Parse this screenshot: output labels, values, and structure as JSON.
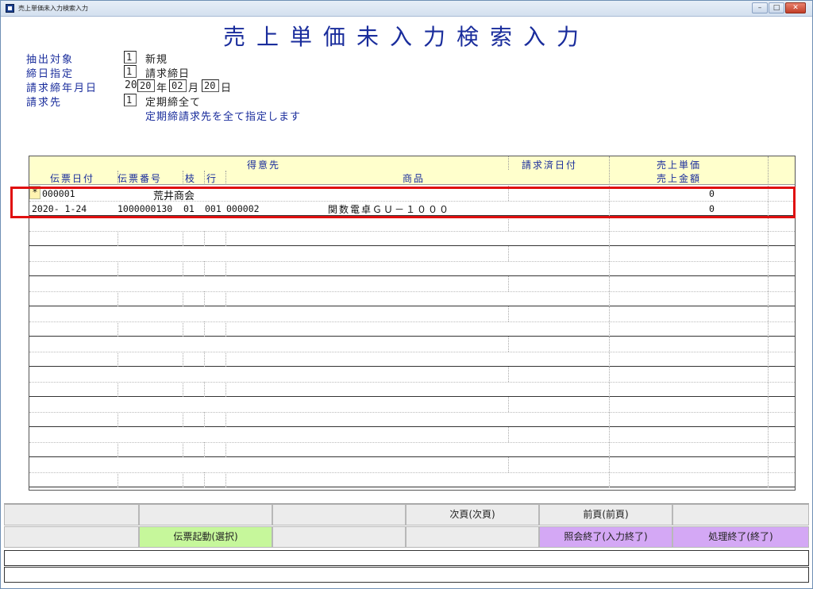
{
  "window": {
    "title": "売上単価未入力検索入力"
  },
  "heading": "売上単価未入力検索入力",
  "form": {
    "extract": {
      "label": "抽出対象",
      "value": "1",
      "desc": "新規"
    },
    "closing_spec": {
      "label": "締日指定",
      "value": "1",
      "desc": "請求締日"
    },
    "closing_date": {
      "label": "請求締年月日",
      "era_prefix": "20",
      "year": "20",
      "year_unit": "年",
      "month": "02",
      "month_unit": "月",
      "day": "20",
      "day_unit": "日"
    },
    "billing": {
      "label": "請求先",
      "value": "1",
      "desc": "定期締全て",
      "note": "定期締請求先を全て指定します"
    }
  },
  "grid": {
    "headers": {
      "customer": "得意先",
      "billed_date": "請求済日付",
      "unit_price": "売上単価",
      "slip_date": "伝票日付",
      "slip_no": "伝票番号",
      "branch": "枝",
      "line": "行",
      "product": "商品",
      "amount": "売上金額"
    },
    "rows": [
      {
        "marker": "*",
        "customer_code": "000001",
        "customer_name": "荒井商会",
        "unit_price": "0",
        "slip_date": "2020- 1-24",
        "slip_no": "1000000130",
        "branch": "01",
        "line": "001",
        "product_code": "000002",
        "product_name": "関数電卓ＧＵ－１０００",
        "amount": "0"
      }
    ]
  },
  "function_keys": {
    "row1": [
      "",
      "",
      "",
      "次頁(次頁)",
      "前頁(前頁)",
      ""
    ],
    "row2": [
      "",
      "伝票起動(選択)",
      "",
      "",
      "照会終了(入力終了)",
      "処理終了(終了)"
    ]
  },
  "colors": {
    "accent": "#1a2d9c",
    "header_bg": "#ffffcc",
    "highlight": "#e01010",
    "green_key": "#c6f79b",
    "purple_key": "#d4a8f5"
  }
}
